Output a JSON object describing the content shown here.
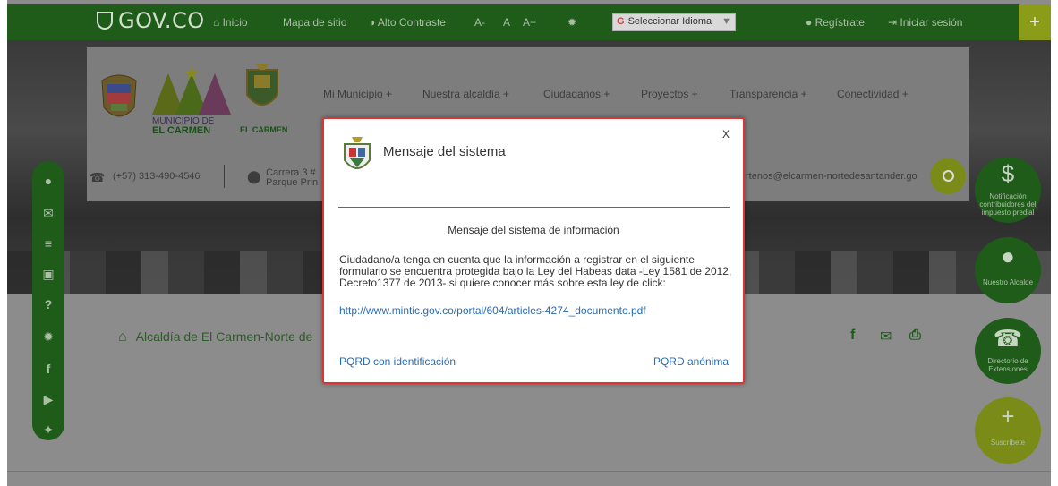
{
  "topbar": {
    "logo": "GOV.CO",
    "inicio": "Inicio",
    "mapa": "Mapa de sitio",
    "contraste": "Alto Contraste",
    "font_minus": "A-",
    "font_normal": "A",
    "font_plus": "A+",
    "idioma": "Seleccionar Idioma",
    "registrate": "Regístrate",
    "iniciar": "Iniciar sesión",
    "plus": "+"
  },
  "brand": {
    "municipio_line1": "MUNICIPIO DE",
    "municipio_line2": "EL CARMEN",
    "alcaldia": "EL CARMEN"
  },
  "menu": [
    "Mi Municipio +",
    "Nuestra alcaldía +",
    "Ciudadanos +",
    "Proyectos +",
    "Transparencia +",
    "Conectividad +"
  ],
  "contact": {
    "phone": "(+57) 313-490-4546",
    "address_line1": "Carrera 3 #",
    "address_line2": "Parque Prin",
    "email": "rtenos@elcarmen-nortedesantander.go"
  },
  "breadcrumb": {
    "text": "Alcaldía de El Carmen-Norte de"
  },
  "right_buttons": [
    {
      "label": "Notificación contribuidores del impuesto predial"
    },
    {
      "label": "Nuestro Alcalde"
    },
    {
      "label": "Directorio de Extensiones"
    },
    {
      "label": "Suscríbete"
    }
  ],
  "modal": {
    "close": "X",
    "title": "Mensaje del sistema",
    "subtitle": "Mensaje del sistema de información",
    "body": "Ciudadano/a tenga en cuenta que la información a registrar en el siguiente formulario se encuentra protegida bajo la Ley del Habeas data -Ley 1581 de 2012, Decreto1377 de 2013- si quiere conocer más sobre esta ley de click:",
    "link": "http://www.mintic.gov.co/portal/604/articles-4274_documento.pdf",
    "pqrd_id": "PQRD con identificación",
    "pqrd_anon": "PQRD anónima"
  },
  "colors": {
    "green_dark": "#1f5c1a",
    "olive": "#7a8b17",
    "modal_border": "#dd3333",
    "link": "#2b6cb0"
  }
}
